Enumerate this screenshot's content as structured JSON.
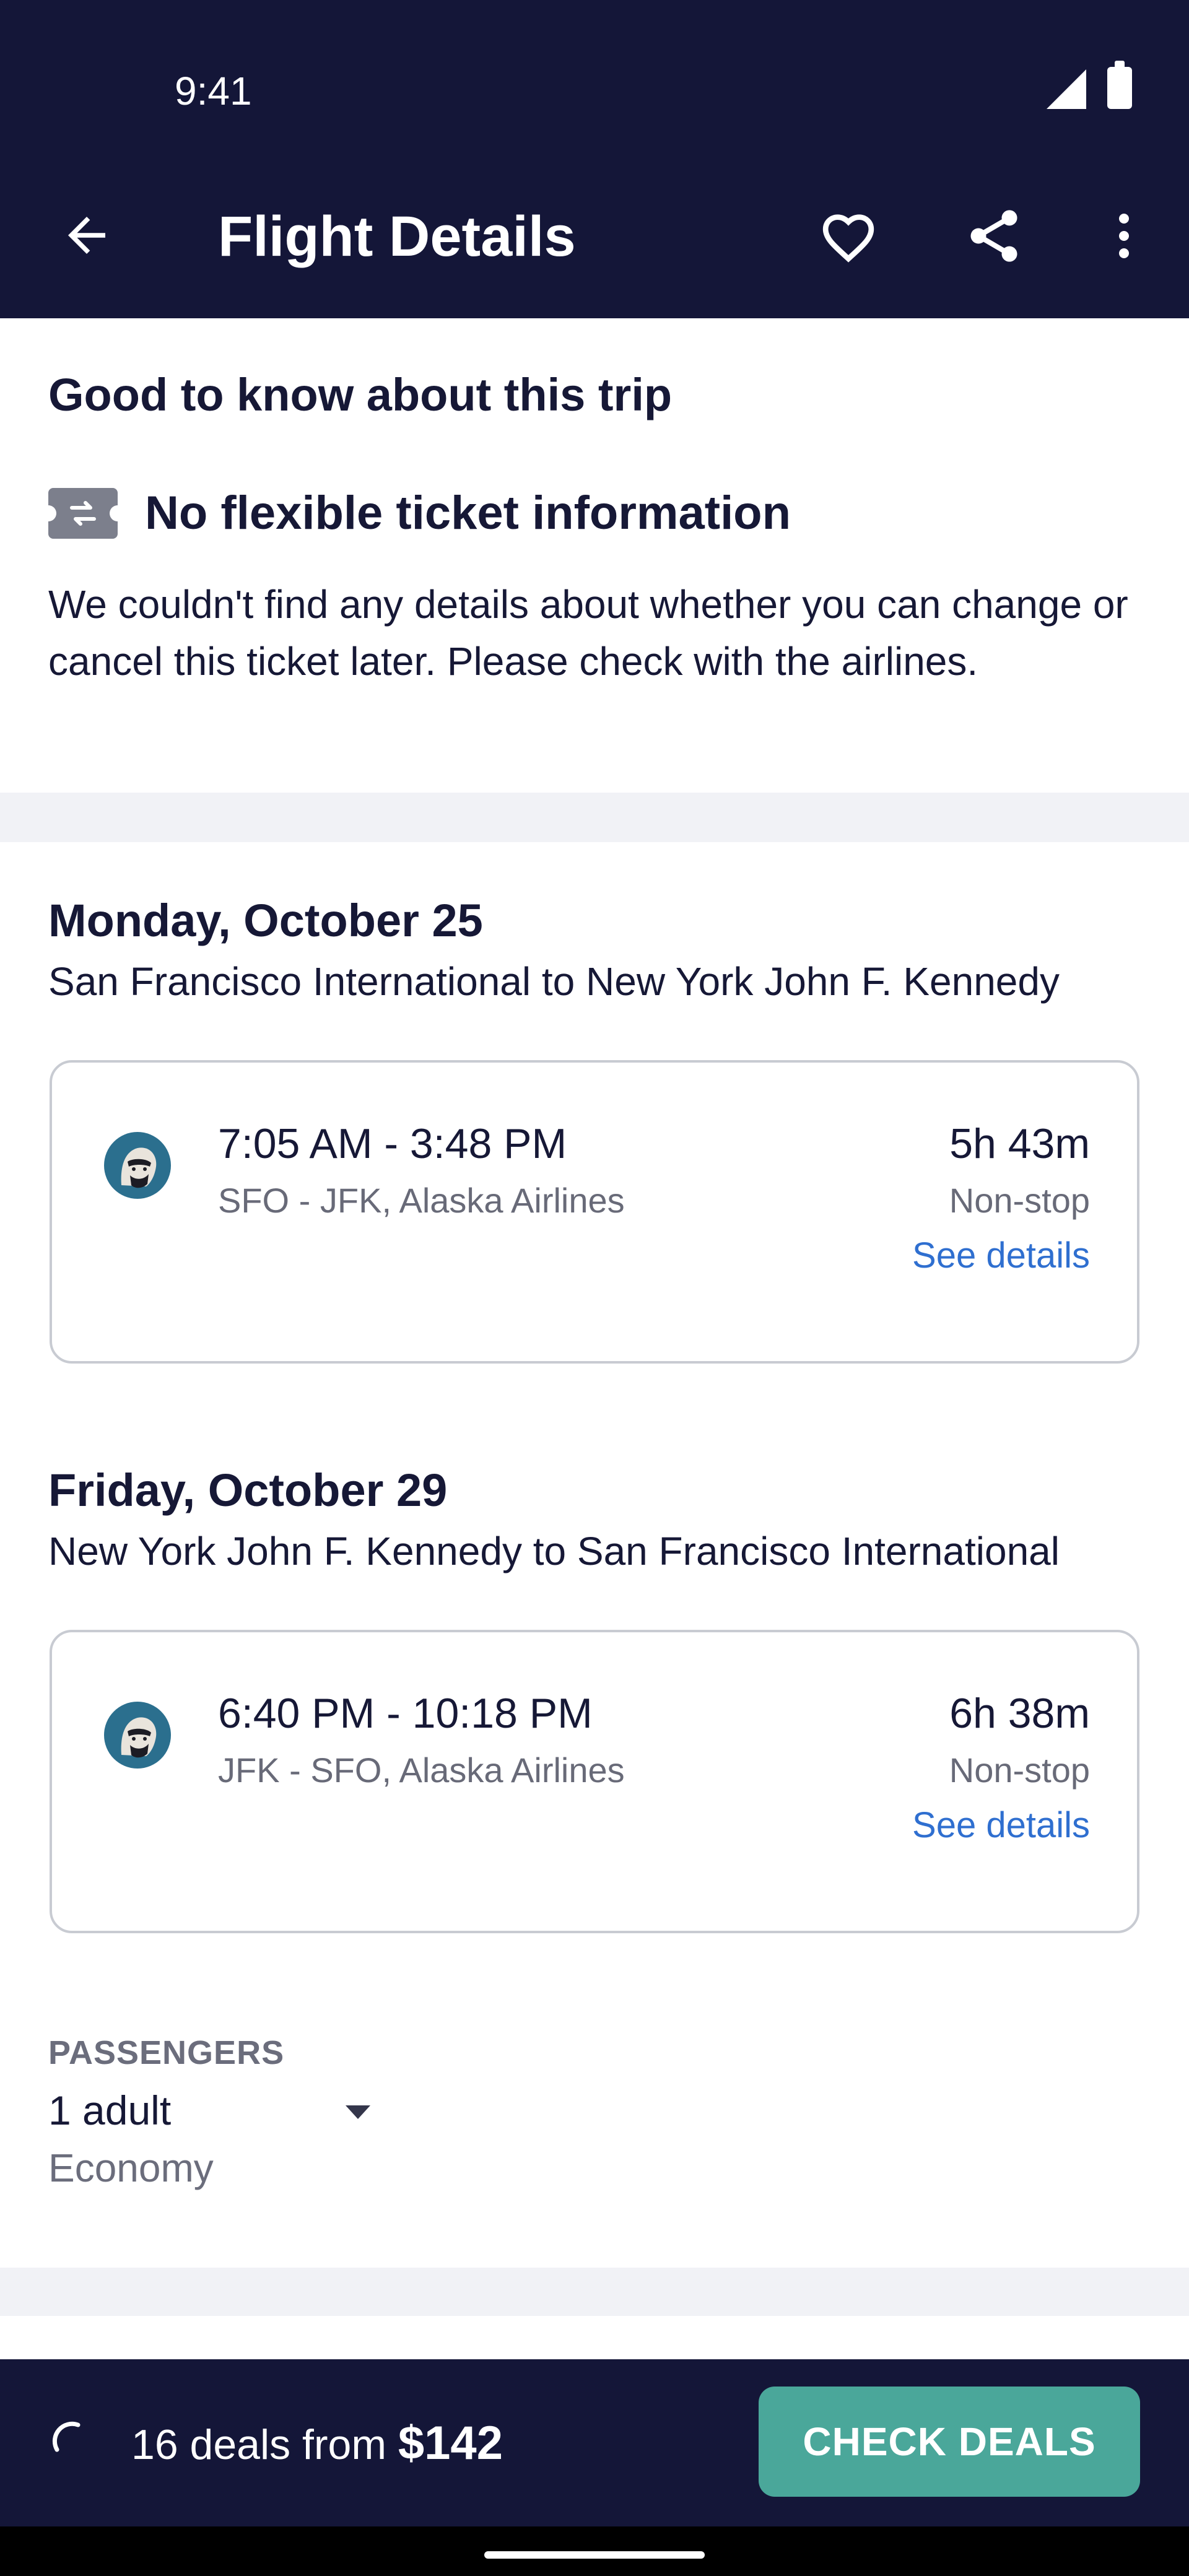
{
  "status_bar": {
    "time": "9:41"
  },
  "app_bar": {
    "title": "Flight Details"
  },
  "good_to_know": {
    "heading": "Good to know about this trip",
    "item_title": "No flexible ticket information",
    "item_description": "We couldn't find any details about whether you can change or cancel this ticket later. Please check with the airlines."
  },
  "legs": [
    {
      "date": "Monday, October 25",
      "route": "San Francisco International to New York John F. Kennedy",
      "times": "7:05 AM - 3:48 PM",
      "route_airline": "SFO - JFK, Alaska Airlines",
      "duration": "5h 43m",
      "stops": "Non-stop",
      "details_link": "See details"
    },
    {
      "date": "Friday, October 29",
      "route": "New York John F. Kennedy to San Francisco International",
      "times": "6:40 PM - 10:18 PM",
      "route_airline": "JFK - SFO, Alaska Airlines",
      "duration": "6h 38m",
      "stops": "Non-stop",
      "details_link": "See details"
    }
  ],
  "passengers": {
    "label": "PASSENGERS",
    "value": "1 adult",
    "cabin": "Economy"
  },
  "bottom_bar": {
    "deals_prefix": "16 deals from ",
    "price": "$142",
    "cta": "CHECK DEALS"
  },
  "colors": {
    "header_bg": "#141638",
    "accent_link": "#2f6fd0",
    "cta_bg": "#4aa79a",
    "divider": "#f1f2f6"
  },
  "icons": [
    "back-arrow-icon",
    "heart-icon",
    "share-icon",
    "more-vert-icon",
    "ticket-exchange-icon",
    "alaska-airlines-logo-icon",
    "dropdown-caret-icon",
    "loading-spinner-icon"
  ]
}
